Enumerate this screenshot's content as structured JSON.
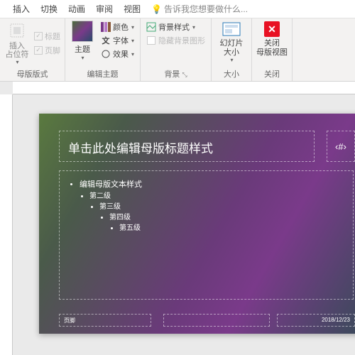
{
  "tabs": {
    "insert": "插入",
    "transition": "切换",
    "animation": "动画",
    "review": "审阅",
    "view": "视图",
    "tellme": "告诉我您想要做什么..."
  },
  "ribbon": {
    "layout": {
      "insertPlaceholder": "插入\n占位符",
      "title": "标题",
      "footer": "页脚",
      "group": "母版版式"
    },
    "theme": {
      "themes": "主题",
      "colors": "颜色",
      "fonts": "字体",
      "effects": "效果",
      "group": "编辑主题"
    },
    "background": {
      "styles": "背景样式",
      "hide": "隐藏背景图形",
      "group": "背景"
    },
    "size": {
      "label": "幻灯片\n大小",
      "group": "大小"
    },
    "close": {
      "label": "关闭\n母版视图",
      "group": "关闭"
    }
  },
  "slide": {
    "titlePrompt": "单击此处编辑母版标题样式",
    "body0": "编辑母版文本样式",
    "body1": "第二级",
    "body2": "第三级",
    "body3": "第四级",
    "body4": "第五级",
    "pageNum": "‹#›",
    "footerLeft": "页脚",
    "date": "2018/12/23"
  }
}
